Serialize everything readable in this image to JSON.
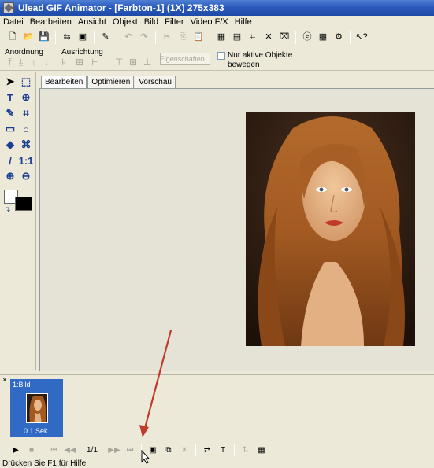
{
  "window": {
    "title": "Ulead GIF Animator - [Farbton-1] (1X) 275x383"
  },
  "menu": [
    "Datei",
    "Bearbeiten",
    "Ansicht",
    "Objekt",
    "Bild",
    "Filter",
    "Video F/X",
    "Hilfe"
  ],
  "toolbar2": {
    "arrange_label": "Anordnung",
    "align_label": "Ausrichtung",
    "properties_button": "Eigenschaften...",
    "only_active_label": "Nur aktive Objekte bewegen"
  },
  "tabs": [
    "Bearbeiten",
    "Optimieren",
    "Vorschau"
  ],
  "frame": {
    "label": "1:Bild",
    "delay": "0.1 Sek."
  },
  "playback": {
    "counter": "1/1"
  },
  "status": "Drücken Sie F1 für Hilfe",
  "colors": {
    "foreground": "#ffffff",
    "background": "#000000",
    "accent": "#316ac5",
    "arrow": "#c0392b"
  }
}
